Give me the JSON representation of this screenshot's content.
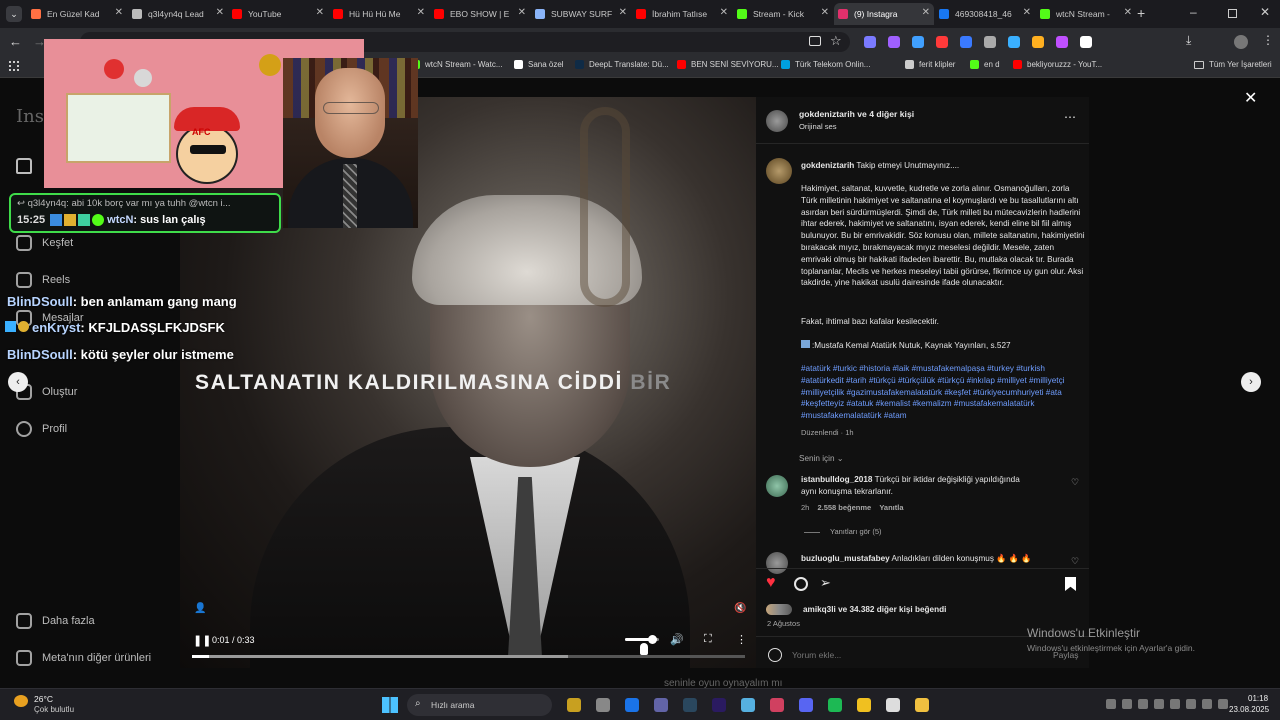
{
  "browser": {
    "tabs": [
      {
        "title": "En Güzel Kad",
        "color": "#ff7043"
      },
      {
        "title": "q3l4yn4q Lead",
        "color": "#bbbbbb"
      },
      {
        "title": "YouTube",
        "color": "#ff0000"
      },
      {
        "title": "Hü Hü Hü Me",
        "color": "#ff0000"
      },
      {
        "title": "EBO SHOW | E",
        "color": "#ff0000"
      },
      {
        "title": "SUBWAY SURF",
        "color": "#8ab4f8"
      },
      {
        "title": "İbrahim Tatlıse",
        "color": "#ff0000"
      },
      {
        "title": "Stream - Kick",
        "color": "#53fc18"
      },
      {
        "title": "(9) Instagra",
        "color": "#e1306c"
      },
      {
        "title": "469308418_46",
        "color": "#1877f2"
      },
      {
        "title": "wtcN Stream -",
        "color": "#53fc18"
      }
    ],
    "bookmarks": [
      {
        "label": "wtcN Stream - Watc...",
        "color": "#53fc18"
      },
      {
        "label": "Sana özel",
        "color": "#ffffff"
      },
      {
        "label": "DeepL Translate: Dü...",
        "color": "#0f2b46"
      },
      {
        "label": "BEN SENİ SEVİYORU...",
        "color": "#ff0000"
      },
      {
        "label": "Türk Telekom Onlin...",
        "color": "#00a0df"
      },
      {
        "label": "ferit klipler",
        "color": "#cccccc"
      },
      {
        "label": "en d",
        "color": "#53fc18"
      },
      {
        "label": "bekliyoruzzz - YouT...",
        "color": "#ff0000"
      }
    ],
    "all_bookmarks": "Tüm Yer İşaretleri"
  },
  "instagram": {
    "nav": [
      {
        "label": "Keşfet",
        "icon": "compass-icon"
      },
      {
        "label": "Reels",
        "icon": "reels-icon"
      },
      {
        "label": "Mesajlar",
        "icon": "message-icon"
      },
      {
        "label": "Oluştur",
        "icon": "plus-icon"
      },
      {
        "label": "Profil",
        "icon": "profile-icon"
      },
      {
        "label": "Daha fazla",
        "icon": "menu-icon"
      },
      {
        "label": "Meta'nın diğer ürünleri",
        "icon": "meta-icon"
      }
    ],
    "video": {
      "subtitle_main": "SALTANATIN KALDIRILMASINA CİDDİ",
      "subtitle_fade": "BİR",
      "time": "0:01 / 0:33",
      "progress": 0.03,
      "buffered": 0.68,
      "volume": 0.8
    },
    "post": {
      "author": "gokdeniztarih",
      "coauthors": "ve 4 diğer kişi",
      "audio": "Orijinal ses",
      "caption_intro": "Takip etmeyi Unutmayınız....",
      "caption_body": "Hakimiyet, saltanat, kuvvetle, kudretle ve zorla alınır. Osmanoğulları, zorla Türk milletinin hakimiyet ve saltanatına el koymuşlardı ve bu tasallutlarını altı asırdan beri sürdürmüşlerdi. Şimdi de, Türk milleti bu mütecavizlerin hadlerini ihtar ederek, hakimiyet ve saltanatını, isyan ederek, kendi eline bil fiil almış bulunuyor. Bu bir emrivakidir. Söz konusu olan, millete saltanatını, hakimiyetini bırakacak mıyız, bırakmayacak mıyız meselesi değildir. Mesele, zaten emrivaki olmuş bir hakikati ifadeden ibarettir. Bu, mutlaka olacak tır. Burada toplananlar, Meclis ve herkes meseleyi tabii görürse, fikrimce uy gun olur. Aksi takdirde, yine hakikat usulü dairesinde ifade olunacaktır.",
      "caption_line2": "Fakat, ihtimal bazı kafalar kesilecektir.",
      "caption_source": ":Mustafa Kemal Atatürk Nutuk, Kaynak Yayınları, s.527",
      "hashtags": "#atatürk #turkic #historia #laik #mustafakemalpaşa #turkey #turkish #atatürkedit #tarih #türkçü #türkçülük #türkçü #inkılap #milliyet #milliyetçi #milliyetçilik #gazimustafakemalatatürk #keşfet #türkiyecumhuriyeti #ata #keşfetteyiz #atatuk #kemalist #kemalizm #mustafakemalatatürk #mustafakemalatatürk #atam",
      "edited": "Düzenlendi · 1h",
      "for_you": "Senin için",
      "comments": [
        {
          "user": "istanbulldog_2018",
          "text": "Türkçü bir iktidar değişikliği yapıldığında aynı konuşma tekrarlanır.",
          "time": "2h",
          "likes": "2.558 beğenme",
          "reply": "Yanıtla",
          "view_replies": "Yanıtları gör (5)"
        },
        {
          "user": "buzluoglu_mustafabey",
          "text": "Anladıkları dilden konuşmuş 🔥 🔥 🔥"
        }
      ],
      "likes_user": "amikq3li",
      "likes_rest": "ve 34.382 diğer kişi beğendi",
      "date": "2 Ağustos",
      "comment_placeholder": "Yorum ekle...",
      "post_button": "Paylaş"
    }
  },
  "overlay": {
    "chat_lines": [
      {
        "user": "BlinDSoull",
        "text": ": ben anlamam gang mang"
      },
      {
        "user": "enKryst",
        "text": ": KFJLDASŞLFKJDSFK"
      },
      {
        "user": "BlinDSoull",
        "text": ": kötü şeyler olur istmeme"
      }
    ],
    "chatbox_reply": "q3l4yn4q: abi 10k borç var mı ya tuhh @wtcn i...",
    "chatbox_time": "15:25",
    "chatbox_user": "wtcN",
    "chatbox_text": ": sus lan çalış",
    "stream_label": "AFC"
  },
  "windows": {
    "activate_title": "Windows'u Etkinleştir",
    "activate_sub": "Windows'u etkinleştirmek için Ayarlar'a gidin.",
    "weather_temp": "26°C",
    "weather_desc": "Çok bulutlu",
    "search": "Hızlı arama",
    "time": "01:18",
    "date": "23.08.2025",
    "bottom_caption": "seninle oyun oynayalım mı"
  }
}
